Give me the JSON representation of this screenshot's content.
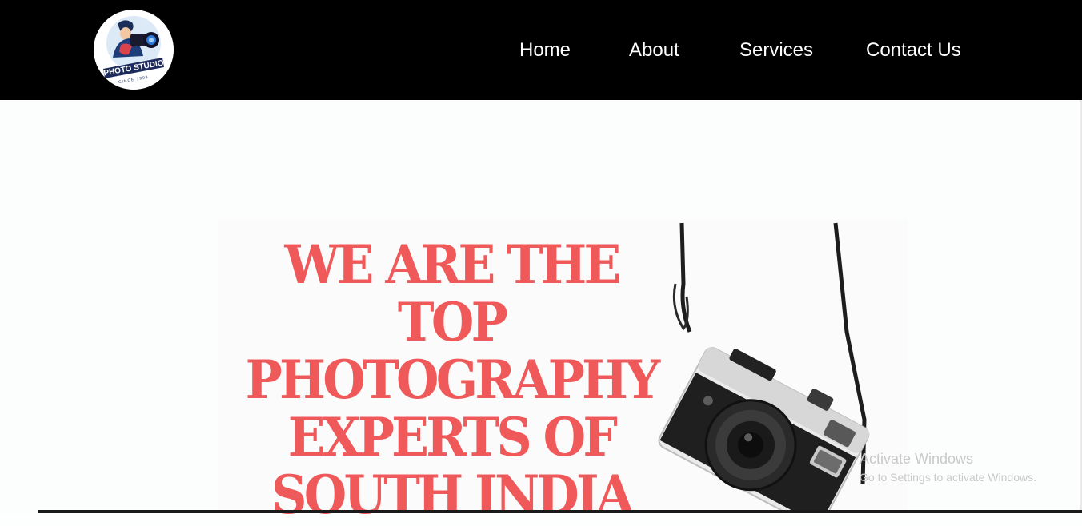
{
  "nav": {
    "logo": {
      "text": "PHOTO STUDIO",
      "tagline": "SINCE 1999"
    },
    "links": [
      {
        "label": "Home"
      },
      {
        "label": "About"
      },
      {
        "label": "Services"
      },
      {
        "label": "Contact Us"
      }
    ]
  },
  "hero": {
    "headline_lines": [
      "WE ARE THE",
      "TOP",
      "PHOTOGRAPHY",
      "EXPERTS OF",
      "SOUTH INDIA"
    ],
    "headline_color": "#f0595a"
  },
  "watermark": {
    "title": "Activate Windows",
    "subtitle": "Go to Settings to activate Windows."
  },
  "colors": {
    "navbar_bg": "#000000",
    "nav_text": "#ffffff",
    "page_bg": "#fdfefe"
  }
}
